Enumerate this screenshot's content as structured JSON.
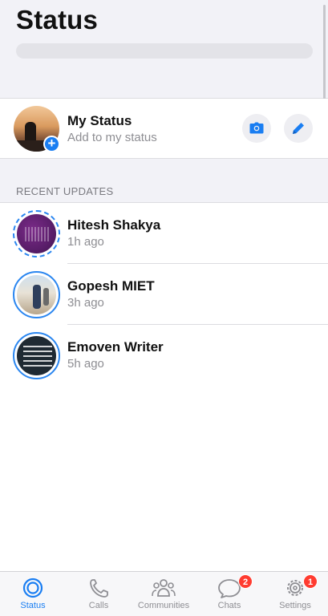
{
  "header": {
    "title": "Status"
  },
  "my_status": {
    "name": "My Status",
    "subtitle": "Add to my status",
    "add_icon": "plus-icon",
    "camera_icon": "camera-icon",
    "pencil_icon": "pencil-icon"
  },
  "section": {
    "label": "RECENT UPDATES"
  },
  "updates": [
    {
      "name": "Hitesh Shakya",
      "time": "1h ago",
      "seen": false
    },
    {
      "name": "Gopesh MIET",
      "time": "3h ago",
      "seen": true
    },
    {
      "name": "Emoven Writer",
      "time": "5h ago",
      "seen": true
    }
  ],
  "tabs": [
    {
      "label": "Status",
      "icon": "status-icon",
      "active": true
    },
    {
      "label": "Calls",
      "icon": "phone-icon"
    },
    {
      "label": "Communities",
      "icon": "communities-icon"
    },
    {
      "label": "Chats",
      "icon": "chats-icon",
      "badge": "2"
    },
    {
      "label": "Settings",
      "icon": "gear-icon",
      "badge": "1"
    }
  ],
  "colors": {
    "accent": "#1a7ef2",
    "badge": "#ff3b30",
    "muted": "#8e8e93"
  }
}
